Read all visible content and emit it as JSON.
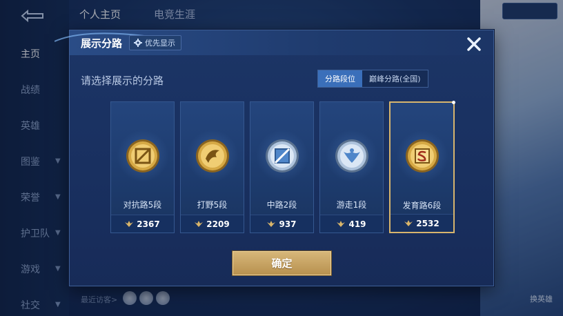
{
  "background": {
    "top_tabs": [
      "个人主页",
      "电竞生涯"
    ],
    "side_nav": [
      {
        "label": "主页",
        "active": true,
        "has_chevron": false
      },
      {
        "label": "战绩",
        "active": false,
        "has_chevron": false
      },
      {
        "label": "英雄",
        "active": false,
        "has_chevron": false
      },
      {
        "label": "图鉴",
        "active": false,
        "has_chevron": true
      },
      {
        "label": "荣誉",
        "active": false,
        "has_chevron": true
      },
      {
        "label": "护卫队",
        "active": false,
        "has_chevron": true
      },
      {
        "label": "游戏",
        "active": false,
        "has_chevron": true
      },
      {
        "label": "社交",
        "active": false,
        "has_chevron": true
      }
    ],
    "recent_visitors_label": "最近访客>",
    "change_hero_label": "换英雄"
  },
  "modal": {
    "title": "展示分路",
    "priority_button": "优先显示",
    "subtitle": "请选择展示的分路",
    "toggle": [
      "分路段位",
      "巅峰分路(全国)"
    ],
    "toggle_selected": 0,
    "cards": [
      {
        "rank": "对抗路5段",
        "points": "2367",
        "selected": false,
        "icon": "clash-lane-badge-icon"
      },
      {
        "rank": "打野5段",
        "points": "2209",
        "selected": false,
        "icon": "jungle-badge-icon"
      },
      {
        "rank": "中路2段",
        "points": "937",
        "selected": false,
        "icon": "mid-lane-badge-icon"
      },
      {
        "rank": "游走1段",
        "points": "419",
        "selected": false,
        "icon": "roam-badge-icon"
      },
      {
        "rank": "发育路6段",
        "points": "2532",
        "selected": true,
        "icon": "farm-lane-badge-icon"
      }
    ],
    "confirm_button": "确定"
  },
  "colors": {
    "modal_bg": "#1c3566",
    "toggle_active": "#3a6fba",
    "gold_accent": "#d8b56d",
    "badge_gold": "#c8962e"
  }
}
